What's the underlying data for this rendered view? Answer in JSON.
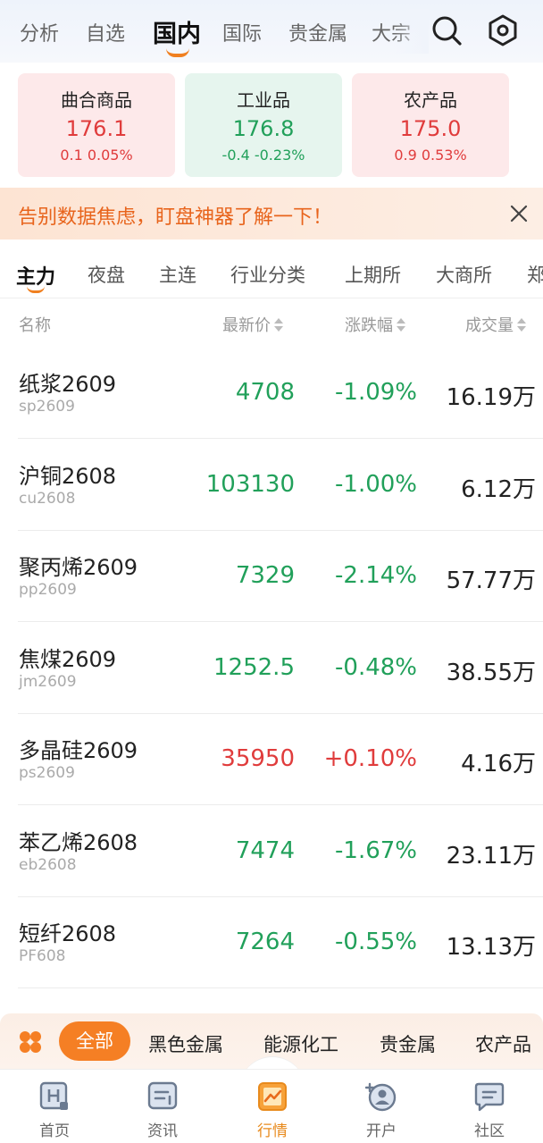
{
  "top_tabs": [
    {
      "label": "分析",
      "active": false
    },
    {
      "label": "自选",
      "active": false
    },
    {
      "label": "国内",
      "active": true
    },
    {
      "label": "国际",
      "active": false
    },
    {
      "label": "贵金属",
      "active": false
    },
    {
      "label": "大宗",
      "active": false
    }
  ],
  "top_icons": {
    "search": "search-icon",
    "settings": "hexagon-settings-icon"
  },
  "index_cards": [
    {
      "name": "曲合商品",
      "value": "176.1",
      "change": "0.1  0.05%",
      "trend": "up"
    },
    {
      "name": "工业品",
      "value": "176.8",
      "change": "-0.4  -0.23%",
      "trend": "down"
    },
    {
      "name": "农产品",
      "value": "175.0",
      "change": "0.9  0.53%",
      "trend": "up"
    }
  ],
  "banner": {
    "text": "告别数据焦虑，盯盘神器了解一下！",
    "close_icon": "close-icon"
  },
  "sub_tabs": [
    {
      "label": "主力",
      "active": true
    },
    {
      "label": "夜盘",
      "active": false
    },
    {
      "label": "主连",
      "active": false
    },
    {
      "label": "行业分类",
      "active": false
    },
    {
      "label": "上期所",
      "active": false
    },
    {
      "label": "大商所",
      "active": false
    },
    {
      "label": "郑",
      "active": false
    }
  ],
  "table": {
    "headers": {
      "name": "名称",
      "price": "最新价",
      "change": "涨跌幅",
      "volume": "成交量"
    },
    "rows": [
      {
        "name": "纸浆2609",
        "code": "sp2609",
        "price": "4708",
        "change": "-1.09%",
        "volume": "16.19万",
        "trend": "down"
      },
      {
        "name": "沪铜2608",
        "code": "cu2608",
        "price": "103130",
        "change": "-1.00%",
        "volume": "6.12万",
        "trend": "down"
      },
      {
        "name": "聚丙烯2609",
        "code": "pp2609",
        "price": "7329",
        "change": "-2.14%",
        "volume": "57.77万",
        "trend": "down"
      },
      {
        "name": "焦煤2609",
        "code": "jm2609",
        "price": "1252.5",
        "change": "-0.48%",
        "volume": "38.55万",
        "trend": "down"
      },
      {
        "name": "多晶硅2609",
        "code": "ps2609",
        "price": "35950",
        "change": "+0.10%",
        "volume": "4.16万",
        "trend": "up"
      },
      {
        "name": "苯乙烯2608",
        "code": "eb2608",
        "price": "7474",
        "change": "-1.67%",
        "volume": "23.11万",
        "trend": "down"
      },
      {
        "name": "短纤2608",
        "code": "PF608",
        "price": "7264",
        "change": "-0.55%",
        "volume": "13.13万",
        "trend": "down"
      }
    ]
  },
  "category_bar": {
    "active_label": "全部",
    "items": [
      "黑色金属",
      "能源化工",
      "贵金属",
      "农产品"
    ]
  },
  "bottom_nav": [
    {
      "label": "首页",
      "icon": "home-h-icon",
      "active": false
    },
    {
      "label": "资讯",
      "icon": "news-icon",
      "active": false
    },
    {
      "label": "行情",
      "icon": "market-chart-icon",
      "active": true
    },
    {
      "label": "开户",
      "icon": "account-open-icon",
      "active": false
    },
    {
      "label": "社区",
      "icon": "community-chat-icon",
      "active": false
    }
  ],
  "colors": {
    "up": "#e03c3c",
    "down": "#21a05a",
    "accent": "#f57f24"
  }
}
